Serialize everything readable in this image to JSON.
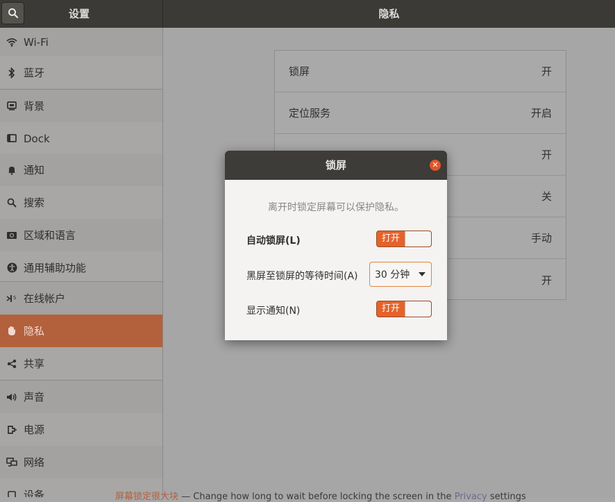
{
  "header": {
    "settings_title": "设置",
    "page_title": "隐私"
  },
  "sidebar": {
    "items": [
      {
        "label": "Wi-Fi",
        "icon": "wifi-icon"
      },
      {
        "label": "蓝牙",
        "icon": "bluetooth-icon"
      },
      {
        "label": "背景",
        "icon": "background-icon"
      },
      {
        "label": "Dock",
        "icon": "dock-icon"
      },
      {
        "label": "通知",
        "icon": "bell-icon"
      },
      {
        "label": "搜索",
        "icon": "search-icon"
      },
      {
        "label": "区域和语言",
        "icon": "region-icon"
      },
      {
        "label": "通用辅助功能",
        "icon": "accessibility-icon"
      },
      {
        "label": "在线帐户",
        "icon": "online-accounts-icon"
      },
      {
        "label": "隐私",
        "icon": "hand-icon"
      },
      {
        "label": "共享",
        "icon": "share-icon"
      },
      {
        "label": "声音",
        "icon": "speaker-icon"
      },
      {
        "label": "电源",
        "icon": "power-icon"
      },
      {
        "label": "网络",
        "icon": "network-icon"
      },
      {
        "label": "设备",
        "icon": "devices-icon"
      }
    ],
    "selected": "隐私"
  },
  "privacy": {
    "rows": [
      {
        "label": "锁屏",
        "value": "开"
      },
      {
        "label": "定位服务",
        "value": "开启"
      },
      {
        "label": "",
        "value": "开"
      },
      {
        "label": "",
        "value": "关"
      },
      {
        "label": "",
        "value": "手动"
      },
      {
        "label": "",
        "value": "开"
      }
    ]
  },
  "dialog": {
    "title": "锁屏",
    "description": "离开时锁定屏幕可以保护隐私。",
    "auto_lock_label": "自动锁屏(L)",
    "auto_lock_state": "打开",
    "delay_label": "黑屏至锁屏的等待时间(A)",
    "delay_value": "30 分钟",
    "show_notifications_label": "显示通知(N)",
    "show_notifications_state": "打开"
  },
  "tooltip_bottom": {
    "title": "屏幕锁定很大块",
    "dash": "— Change how long to wait before locking the screen in the",
    "link": "Privacy",
    "tail": "settings"
  },
  "colors": {
    "accent": "#e5622a",
    "selected_bg": "#b3603d",
    "header_bg": "#3b3a36"
  }
}
